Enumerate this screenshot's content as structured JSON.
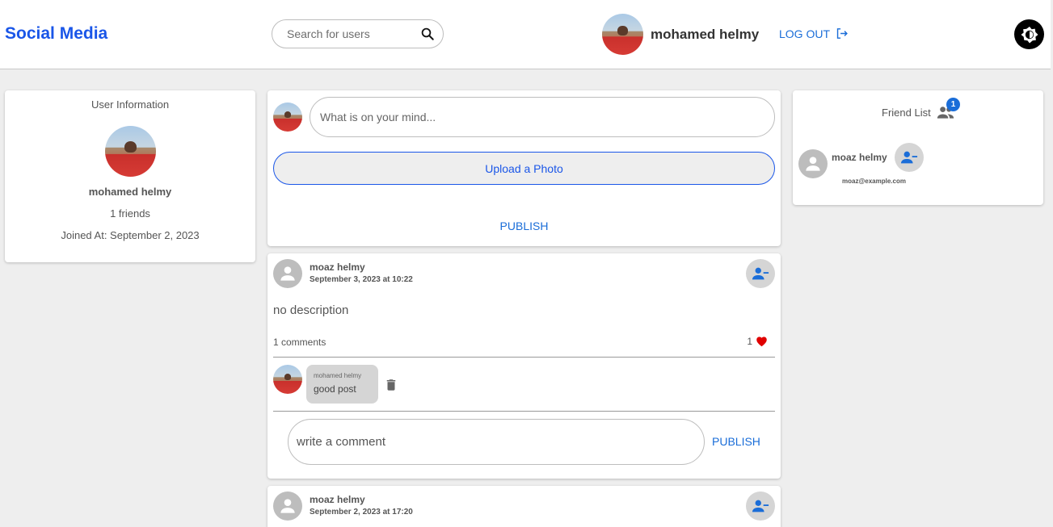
{
  "app": {
    "title": "Social Media"
  },
  "header": {
    "search_placeholder": "Search for users",
    "user_name": "mohamed helmy",
    "logout_label": "LOG OUT"
  },
  "user_info": {
    "title": "User Information",
    "name": "mohamed helmy",
    "friends": "1 friends",
    "joined": "Joined At: September 2, 2023"
  },
  "composer": {
    "placeholder": "What is on your mind...",
    "upload_label": "Upload a Photo",
    "publish_label": "PUBLISH"
  },
  "posts": [
    {
      "author": "moaz helmy",
      "date": "September 3, 2023 at 10:22",
      "description": "no description",
      "comments_count": "1 comments",
      "likes": "1",
      "comments": [
        {
          "author": "mohamed helmy",
          "text": "good post"
        }
      ],
      "comment_placeholder": "write a comment",
      "comment_publish": "PUBLISH"
    },
    {
      "author": "moaz helmy",
      "date": "September 2, 2023 at 17:20"
    }
  ],
  "friend_list": {
    "title": "Friend List",
    "badge": "1",
    "friends": [
      {
        "name": "moaz helmy",
        "email": "moaz@example.com"
      }
    ]
  },
  "colors": {
    "accent": "#1a56e8",
    "link": "#1a6dd8",
    "like": "#e00000"
  },
  "icons": [
    "search-icon",
    "logout-icon",
    "theme-toggle-icon",
    "person-icon",
    "person-remove-icon",
    "heart-icon",
    "trash-icon",
    "group-icon"
  ]
}
